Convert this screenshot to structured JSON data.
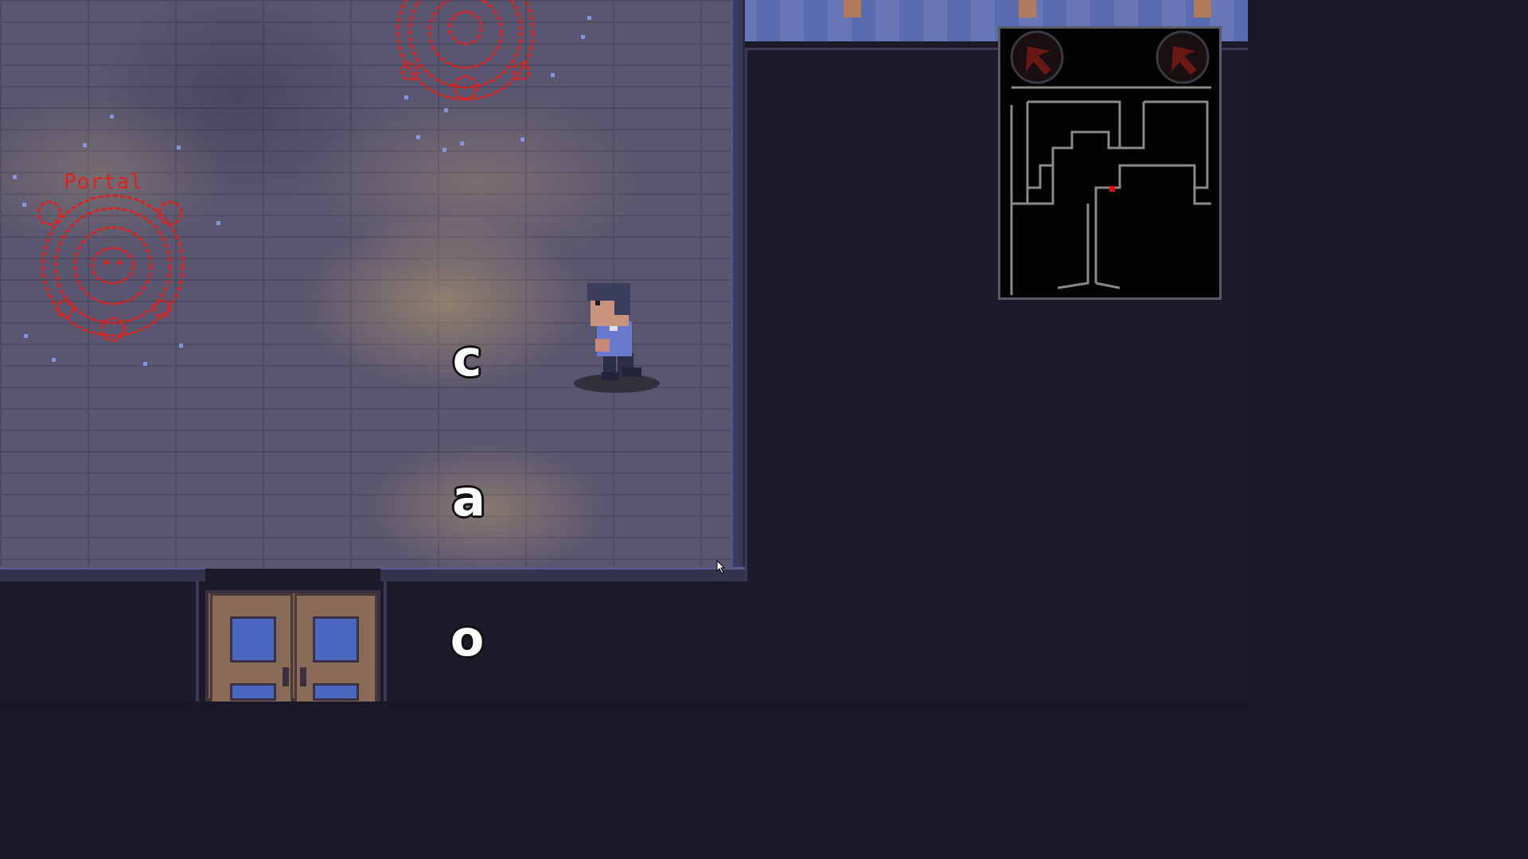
{
  "scene": {
    "portal_label": "Portal",
    "letters": [
      "c",
      "a",
      "o"
    ]
  },
  "minimap": {
    "icons": [
      "compass-icon",
      "compass-icon"
    ],
    "player_marker_color": "#e01010"
  },
  "colors": {
    "portal": "#e0201c",
    "floor": "#5a5670",
    "sparkle": "#8fa3ff"
  }
}
